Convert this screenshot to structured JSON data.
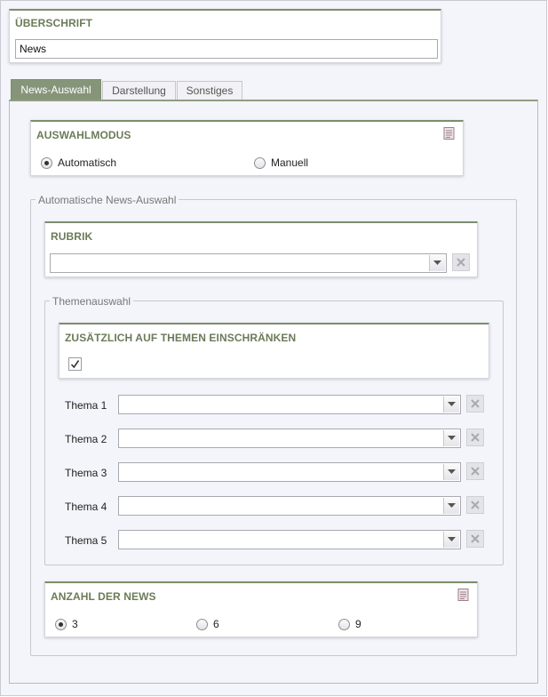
{
  "headline": {
    "title": "ÜBERSCHRIFT",
    "value": "News"
  },
  "tabs": [
    {
      "label": "News-Auswahl",
      "active": true
    },
    {
      "label": "Darstellung",
      "active": false
    },
    {
      "label": "Sonstiges",
      "active": false
    }
  ],
  "mode": {
    "title": "AUSWAHLMODUS",
    "options": [
      {
        "label": "Automatisch",
        "checked": true
      },
      {
        "label": "Manuell",
        "checked": false
      }
    ]
  },
  "auto_group": {
    "legend": "Automatische News-Auswahl",
    "rubrik": {
      "title": "RUBRIK",
      "value": ""
    },
    "themes": {
      "legend": "Themenauswahl",
      "restrict": {
        "title": "ZUSÄTZLICH AUF THEMEN EINSCHRÄNKEN",
        "checked": true
      },
      "rows": [
        {
          "label": "Thema 1",
          "value": ""
        },
        {
          "label": "Thema 2",
          "value": ""
        },
        {
          "label": "Thema 3",
          "value": ""
        },
        {
          "label": "Thema 4",
          "value": ""
        },
        {
          "label": "Thema 5",
          "value": ""
        }
      ]
    },
    "count": {
      "title": "ANZAHL DER NEWS",
      "options": [
        {
          "label": "3",
          "checked": true
        },
        {
          "label": "6",
          "checked": false
        },
        {
          "label": "9",
          "checked": false
        }
      ]
    }
  },
  "colors": {
    "accent": "#7d8e6c",
    "title_text": "#6b7b58",
    "background": "#f4f4fb"
  },
  "icons": {
    "help": "document-icon",
    "dropdown": "chevron-down-icon",
    "clear": "close-icon",
    "check": "checkmark-icon"
  }
}
